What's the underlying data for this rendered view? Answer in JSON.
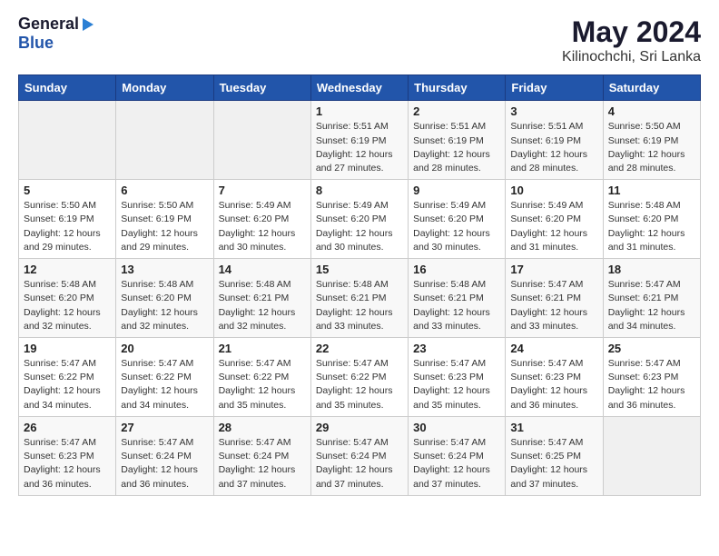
{
  "header": {
    "logo_general": "General",
    "logo_blue": "Blue",
    "title": "May 2024",
    "subtitle": "Kilinochchi, Sri Lanka"
  },
  "calendar": {
    "days_of_week": [
      "Sunday",
      "Monday",
      "Tuesday",
      "Wednesday",
      "Thursday",
      "Friday",
      "Saturday"
    ],
    "weeks": [
      [
        {
          "day": "",
          "info": ""
        },
        {
          "day": "",
          "info": ""
        },
        {
          "day": "",
          "info": ""
        },
        {
          "day": "1",
          "info": "Sunrise: 5:51 AM\nSunset: 6:19 PM\nDaylight: 12 hours\nand 27 minutes."
        },
        {
          "day": "2",
          "info": "Sunrise: 5:51 AM\nSunset: 6:19 PM\nDaylight: 12 hours\nand 28 minutes."
        },
        {
          "day": "3",
          "info": "Sunrise: 5:51 AM\nSunset: 6:19 PM\nDaylight: 12 hours\nand 28 minutes."
        },
        {
          "day": "4",
          "info": "Sunrise: 5:50 AM\nSunset: 6:19 PM\nDaylight: 12 hours\nand 28 minutes."
        }
      ],
      [
        {
          "day": "5",
          "info": "Sunrise: 5:50 AM\nSunset: 6:19 PM\nDaylight: 12 hours\nand 29 minutes."
        },
        {
          "day": "6",
          "info": "Sunrise: 5:50 AM\nSunset: 6:19 PM\nDaylight: 12 hours\nand 29 minutes."
        },
        {
          "day": "7",
          "info": "Sunrise: 5:49 AM\nSunset: 6:20 PM\nDaylight: 12 hours\nand 30 minutes."
        },
        {
          "day": "8",
          "info": "Sunrise: 5:49 AM\nSunset: 6:20 PM\nDaylight: 12 hours\nand 30 minutes."
        },
        {
          "day": "9",
          "info": "Sunrise: 5:49 AM\nSunset: 6:20 PM\nDaylight: 12 hours\nand 30 minutes."
        },
        {
          "day": "10",
          "info": "Sunrise: 5:49 AM\nSunset: 6:20 PM\nDaylight: 12 hours\nand 31 minutes."
        },
        {
          "day": "11",
          "info": "Sunrise: 5:48 AM\nSunset: 6:20 PM\nDaylight: 12 hours\nand 31 minutes."
        }
      ],
      [
        {
          "day": "12",
          "info": "Sunrise: 5:48 AM\nSunset: 6:20 PM\nDaylight: 12 hours\nand 32 minutes."
        },
        {
          "day": "13",
          "info": "Sunrise: 5:48 AM\nSunset: 6:20 PM\nDaylight: 12 hours\nand 32 minutes."
        },
        {
          "day": "14",
          "info": "Sunrise: 5:48 AM\nSunset: 6:21 PM\nDaylight: 12 hours\nand 32 minutes."
        },
        {
          "day": "15",
          "info": "Sunrise: 5:48 AM\nSunset: 6:21 PM\nDaylight: 12 hours\nand 33 minutes."
        },
        {
          "day": "16",
          "info": "Sunrise: 5:48 AM\nSunset: 6:21 PM\nDaylight: 12 hours\nand 33 minutes."
        },
        {
          "day": "17",
          "info": "Sunrise: 5:47 AM\nSunset: 6:21 PM\nDaylight: 12 hours\nand 33 minutes."
        },
        {
          "day": "18",
          "info": "Sunrise: 5:47 AM\nSunset: 6:21 PM\nDaylight: 12 hours\nand 34 minutes."
        }
      ],
      [
        {
          "day": "19",
          "info": "Sunrise: 5:47 AM\nSunset: 6:22 PM\nDaylight: 12 hours\nand 34 minutes."
        },
        {
          "day": "20",
          "info": "Sunrise: 5:47 AM\nSunset: 6:22 PM\nDaylight: 12 hours\nand 34 minutes."
        },
        {
          "day": "21",
          "info": "Sunrise: 5:47 AM\nSunset: 6:22 PM\nDaylight: 12 hours\nand 35 minutes."
        },
        {
          "day": "22",
          "info": "Sunrise: 5:47 AM\nSunset: 6:22 PM\nDaylight: 12 hours\nand 35 minutes."
        },
        {
          "day": "23",
          "info": "Sunrise: 5:47 AM\nSunset: 6:23 PM\nDaylight: 12 hours\nand 35 minutes."
        },
        {
          "day": "24",
          "info": "Sunrise: 5:47 AM\nSunset: 6:23 PM\nDaylight: 12 hours\nand 36 minutes."
        },
        {
          "day": "25",
          "info": "Sunrise: 5:47 AM\nSunset: 6:23 PM\nDaylight: 12 hours\nand 36 minutes."
        }
      ],
      [
        {
          "day": "26",
          "info": "Sunrise: 5:47 AM\nSunset: 6:23 PM\nDaylight: 12 hours\nand 36 minutes."
        },
        {
          "day": "27",
          "info": "Sunrise: 5:47 AM\nSunset: 6:24 PM\nDaylight: 12 hours\nand 36 minutes."
        },
        {
          "day": "28",
          "info": "Sunrise: 5:47 AM\nSunset: 6:24 PM\nDaylight: 12 hours\nand 37 minutes."
        },
        {
          "day": "29",
          "info": "Sunrise: 5:47 AM\nSunset: 6:24 PM\nDaylight: 12 hours\nand 37 minutes."
        },
        {
          "day": "30",
          "info": "Sunrise: 5:47 AM\nSunset: 6:24 PM\nDaylight: 12 hours\nand 37 minutes."
        },
        {
          "day": "31",
          "info": "Sunrise: 5:47 AM\nSunset: 6:25 PM\nDaylight: 12 hours\nand 37 minutes."
        },
        {
          "day": "",
          "info": ""
        }
      ]
    ]
  }
}
